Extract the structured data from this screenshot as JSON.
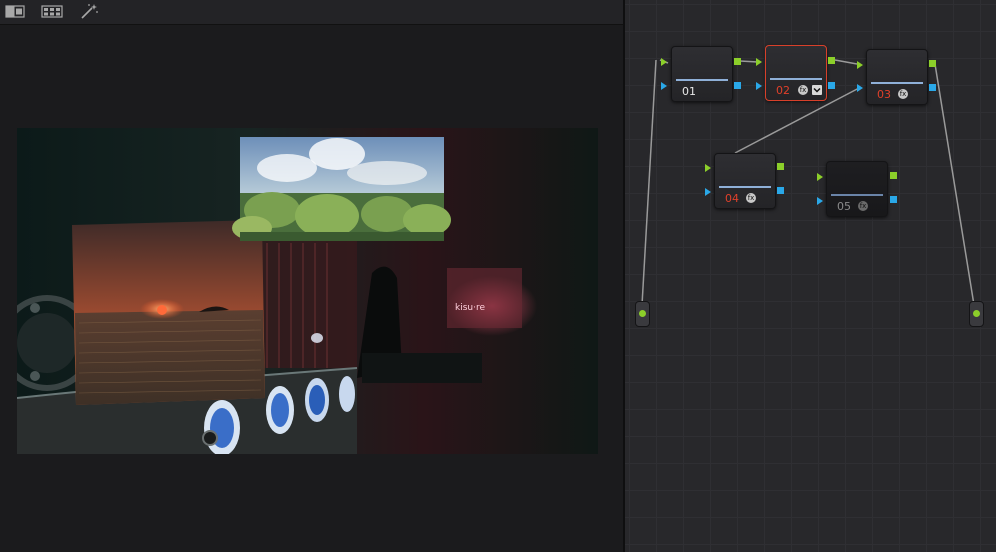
{
  "toolbar": {
    "buttons": [
      {
        "name": "split-view-icon"
      },
      {
        "name": "grid-view-icon"
      },
      {
        "name": "magic-wand-icon"
      }
    ]
  },
  "nodes": [
    {
      "label": "01",
      "selected": false,
      "label_color": "#e8e8e8"
    },
    {
      "label": "02",
      "selected": true,
      "label_color": "#e0402a"
    },
    {
      "label": "03",
      "selected": false,
      "label_color": "#e0402a"
    },
    {
      "label": "04",
      "selected": false,
      "label_color": "#e0402a"
    },
    {
      "label": "05",
      "selected": false,
      "disabled": true,
      "label_color": "#8a8a8a"
    }
  ],
  "colors": {
    "input_port": "#8ccf2a",
    "key_port": "#2aa8e8",
    "selected_border": "#d8402a",
    "connection_line": "#9a9a9a"
  }
}
